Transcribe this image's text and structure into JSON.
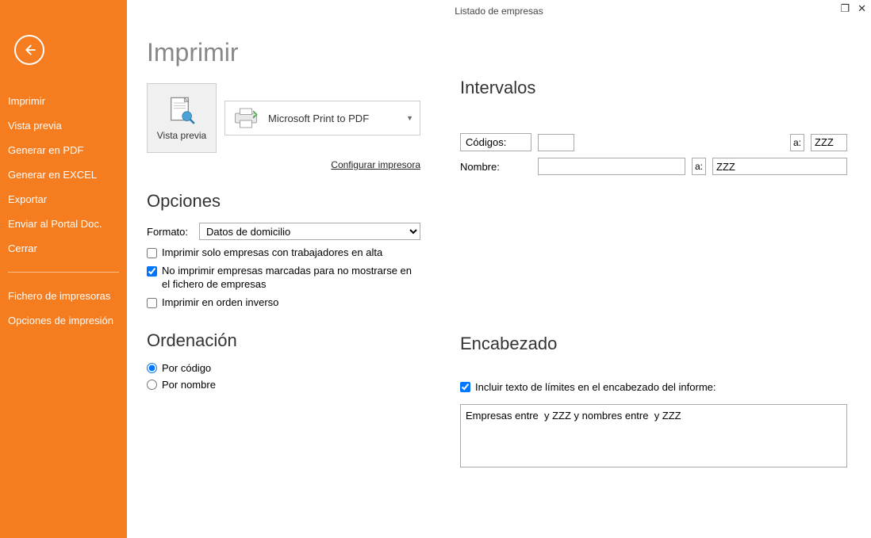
{
  "titlebar": {
    "title": "Listado de empresas"
  },
  "sidebar": {
    "items": [
      "Imprimir",
      "Vista previa",
      "Generar en PDF",
      "Generar en EXCEL",
      "Exportar",
      "Enviar al Portal Doc.",
      "Cerrar"
    ],
    "items2": [
      "Fichero de impresoras",
      "Opciones de impresión"
    ]
  },
  "main": {
    "heading": "Imprimir",
    "preview_label": "Vista previa",
    "printer_name": "Microsoft Print to PDF",
    "config_link": "Configurar impresora",
    "options": {
      "title": "Opciones",
      "format_label": "Formato:",
      "format_value": "Datos de domicilio",
      "chk_alta": "Imprimir solo empresas con trabajadores en alta",
      "chk_nomostrar": "No imprimir empresas marcadas para no mostrarse en el fichero de empresas",
      "chk_inverso": "Imprimir en orden inverso"
    },
    "ordering": {
      "title": "Ordenación",
      "by_code": "Por código",
      "by_name": "Por nombre"
    }
  },
  "intervals": {
    "title": "Intervalos",
    "codes_label": "Códigos:",
    "codes_from": "",
    "to_label": "a:",
    "codes_to": "ZZZ",
    "name_label": "Nombre:",
    "name_from": "",
    "name_to": "ZZZ"
  },
  "header": {
    "title": "Encabezado",
    "chk_label": "Incluir texto de límites en el encabezado del informe:",
    "text": "Empresas entre  y ZZZ y nombres entre  y ZZZ"
  }
}
